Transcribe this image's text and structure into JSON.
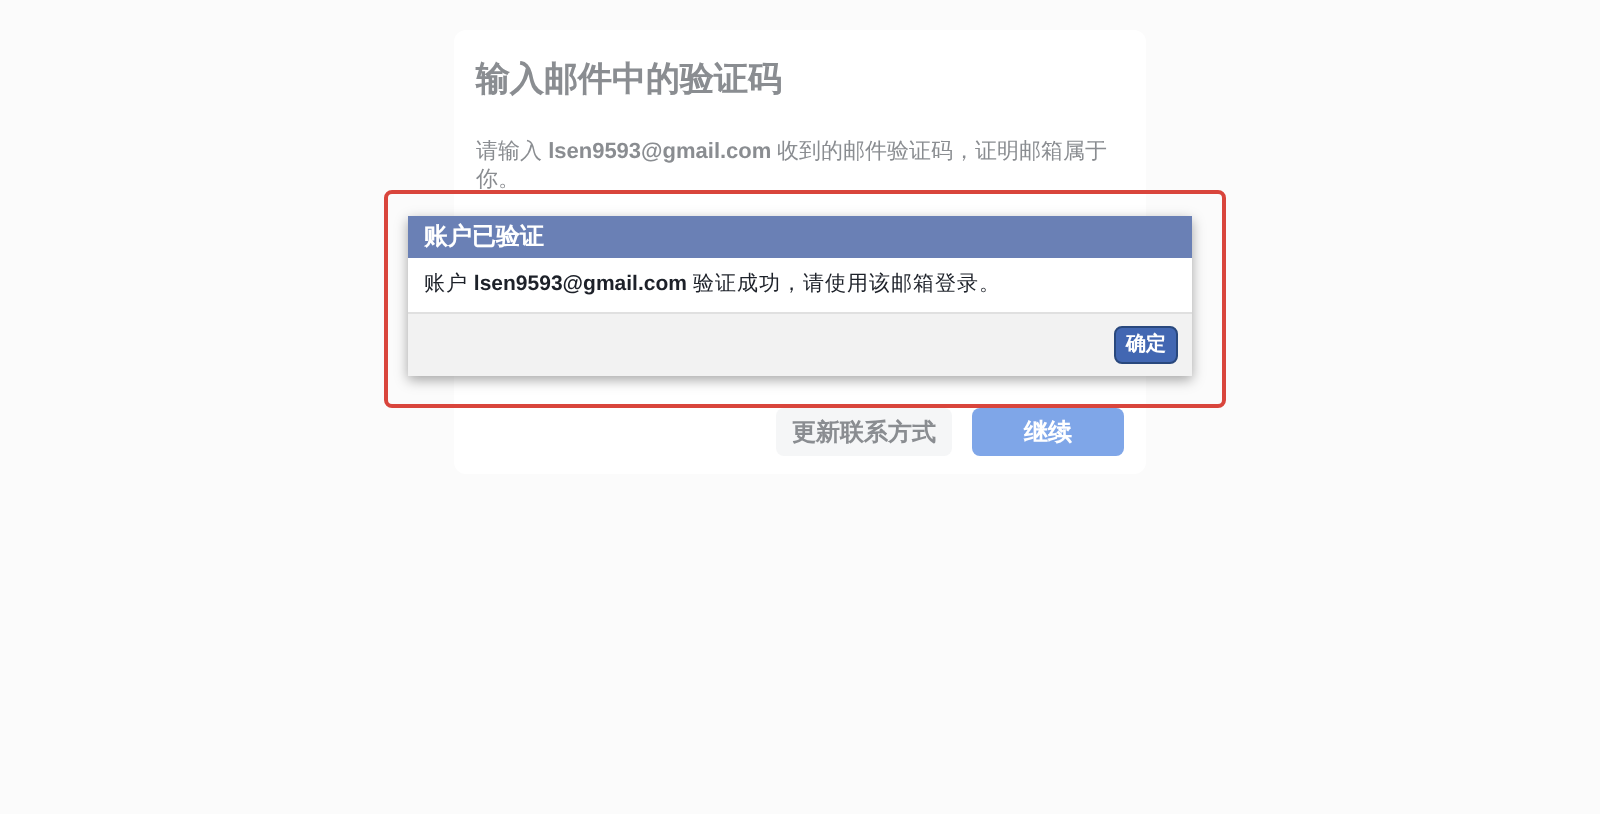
{
  "card": {
    "title": "输入邮件中的验证码",
    "message": "请输入 **lsen9593@gmail.com** 收到的邮件验证码，证明邮箱属于你。",
    "buttons": [
      {
        "label": "更新联系方式",
        "kind": "secondary"
      },
      {
        "label": "继续",
        "kind": "primary"
      }
    ]
  },
  "dialog": {
    "title": "账户已验证",
    "message": "账户 **lsen9593@gmail.com** 验证成功，请使用该邮箱登录。",
    "button": "确定"
  }
}
